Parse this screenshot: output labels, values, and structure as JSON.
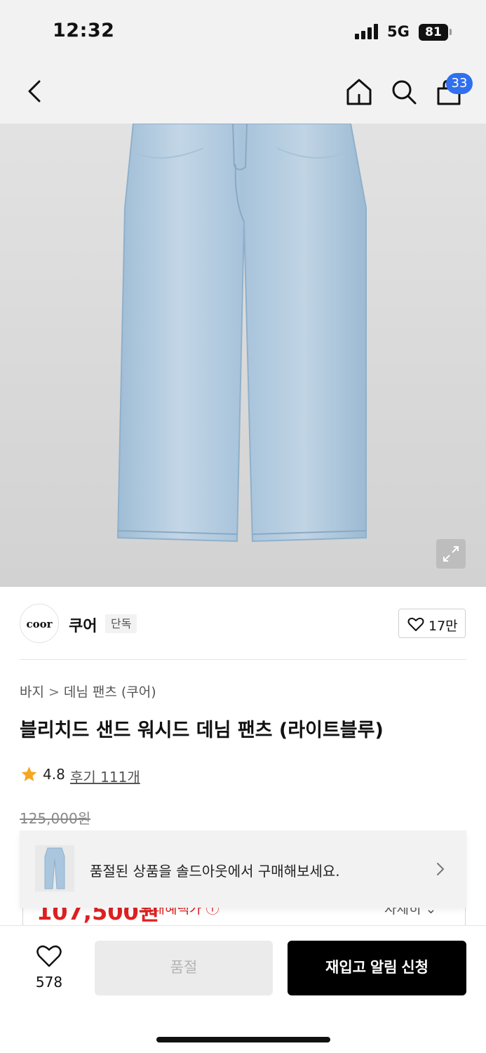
{
  "status_bar": {
    "time": "12:32",
    "network": "5G",
    "battery": "81"
  },
  "nav": {
    "cart_badge": "33"
  },
  "product": {
    "brand": {
      "logo_text": "coor",
      "name": "쿠어",
      "tag": "단독"
    },
    "likes": "17만",
    "breadcrumb": [
      "바지",
      "데님 팬츠 (쿠어)"
    ],
    "title": "블리치드 샌드 워시드 데님 팬츠 (라이트블루)",
    "rating": "4.8",
    "reviews": "후기 111개",
    "original_price": "125,000원",
    "sale_price": "107,500원",
    "sale_note": "최대혜택가 ⓘ",
    "detail_link": "자세히 ⌄"
  },
  "banner": {
    "text": "품절된 상품을 솔드아웃에서 구매해보세요."
  },
  "bottom": {
    "wish_count": "578",
    "soldout_label": "품절",
    "restock_label": "재입고 알림 신청"
  },
  "colors": {
    "accent_blue": "#2f6ff0",
    "sale_red": "#e02020",
    "star": "#f5a623",
    "denim": "#a9c6de"
  },
  "icons": [
    "back-icon",
    "home-icon",
    "search-icon",
    "cart-icon",
    "expand-icon",
    "heart-icon",
    "star-icon",
    "chevron-right-icon"
  ]
}
